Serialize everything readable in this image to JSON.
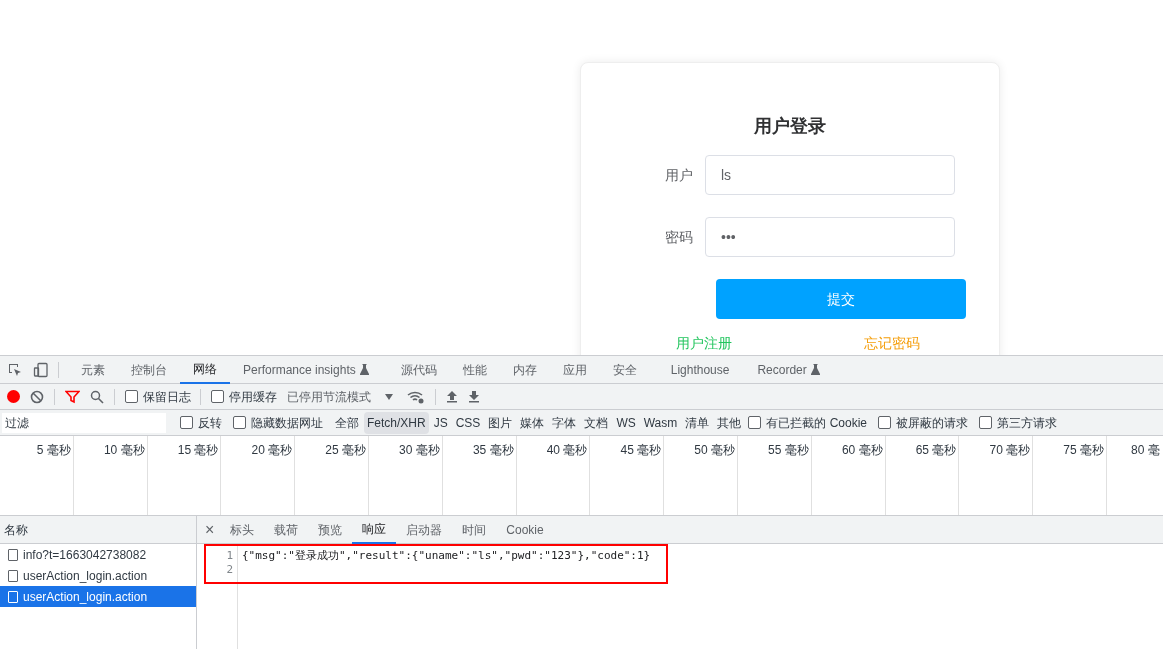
{
  "login": {
    "title": "用户登录",
    "fields": [
      {
        "label": "用户",
        "value": "ls"
      },
      {
        "label": "密码",
        "value": "•••"
      }
    ],
    "submit": "提交",
    "links": [
      {
        "label": "用户注册",
        "color": "#22c55e"
      },
      {
        "label": "忘记密码",
        "color": "#f59e0b"
      }
    ]
  },
  "devtools": {
    "tabs": [
      {
        "label": "元素",
        "selected": false,
        "experimental": false
      },
      {
        "label": "控制台",
        "selected": false,
        "experimental": false
      },
      {
        "label": "网络",
        "selected": true,
        "experimental": false
      },
      {
        "label": "Performance insights",
        "selected": false,
        "experimental": true
      },
      {
        "label": "源代码",
        "selected": false,
        "experimental": false
      },
      {
        "label": "性能",
        "selected": false,
        "experimental": false
      },
      {
        "label": "内存",
        "selected": false,
        "experimental": false
      },
      {
        "label": "应用",
        "selected": false,
        "experimental": false
      },
      {
        "label": "安全",
        "selected": false,
        "experimental": false
      },
      {
        "label": "Lighthouse",
        "selected": false,
        "experimental": false
      },
      {
        "label": "Recorder",
        "selected": false,
        "experimental": true
      }
    ],
    "toolbar": {
      "recording": true,
      "filter_active": true,
      "checkboxes": [
        {
          "label": "保留日志",
          "checked": false
        },
        {
          "label": "停用缓存",
          "checked": false
        }
      ],
      "throttle": "已停用节流模式"
    },
    "filter": {
      "placeholder": "过滤",
      "options": [
        {
          "kind": "checkbox",
          "label": "反转",
          "checked": false
        },
        {
          "kind": "checkbox",
          "label": "隐藏数据网址",
          "checked": false
        },
        {
          "kind": "type",
          "label": "全部",
          "selected": false
        },
        {
          "kind": "type",
          "label": "Fetch/XHR",
          "selected": true
        },
        {
          "kind": "type",
          "label": "JS",
          "selected": false
        },
        {
          "kind": "type",
          "label": "CSS",
          "selected": false
        },
        {
          "kind": "type",
          "label": "图片",
          "selected": false
        },
        {
          "kind": "type",
          "label": "媒体",
          "selected": false
        },
        {
          "kind": "type",
          "label": "字体",
          "selected": false
        },
        {
          "kind": "type",
          "label": "文档",
          "selected": false
        },
        {
          "kind": "type",
          "label": "WS",
          "selected": false
        },
        {
          "kind": "type",
          "label": "Wasm",
          "selected": false
        },
        {
          "kind": "type",
          "label": "清单",
          "selected": false
        },
        {
          "kind": "type",
          "label": "其他",
          "selected": false
        },
        {
          "kind": "checkbox",
          "label": "有已拦截的 Cookie",
          "checked": false
        },
        {
          "kind": "checkbox",
          "label": "被屏蔽的请求",
          "checked": false
        },
        {
          "kind": "checkbox",
          "label": "第三方请求",
          "checked": false
        }
      ]
    },
    "timeline": [
      "5 毫秒",
      "10 毫秒",
      "15 毫秒",
      "20 毫秒",
      "25 毫秒",
      "30 毫秒",
      "35 毫秒",
      "40 毫秒",
      "45 毫秒",
      "50 毫秒",
      "55 毫秒",
      "60 毫秒",
      "65 毫秒",
      "70 毫秒",
      "75 毫秒",
      "80 毫"
    ],
    "requests": {
      "header": "名称",
      "rows": [
        {
          "name": "info?t=1663042738082",
          "selected": false
        },
        {
          "name": "userAction_login.action",
          "selected": false
        },
        {
          "name": "userAction_login.action",
          "selected": true
        }
      ]
    },
    "detail": {
      "close": "×",
      "tabs": [
        {
          "label": "标头",
          "selected": false
        },
        {
          "label": "载荷",
          "selected": false
        },
        {
          "label": "预览",
          "selected": false
        },
        {
          "label": "响应",
          "selected": true
        },
        {
          "label": "启动器",
          "selected": false
        },
        {
          "label": "时间",
          "selected": false
        },
        {
          "label": "Cookie",
          "selected": false
        }
      ],
      "lines": [
        {
          "number": "1",
          "text": "{\"msg\":\"登录成功\",\"result\":{\"uname\":\"ls\",\"pwd\":\"123\"},\"code\":1}"
        },
        {
          "number": "2"
        }
      ]
    }
  }
}
